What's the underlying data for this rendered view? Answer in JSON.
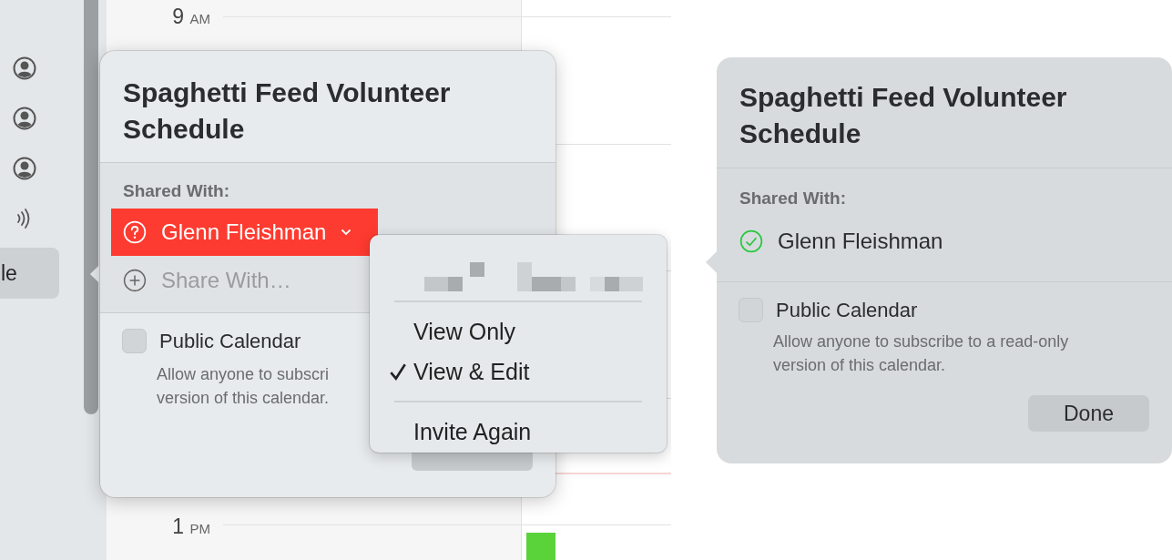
{
  "sidebar": {
    "items": [
      {
        "label": "le",
        "selected": true
      }
    ]
  },
  "calendar": {
    "times": [
      {
        "hour": "9",
        "period": "AM"
      },
      {
        "hour": "1",
        "period": "PM"
      }
    ]
  },
  "popovers": [
    {
      "title": "Spaghetti Feed Volunteer Schedule",
      "shared_with_label": "Shared With:",
      "invitee": {
        "name": "Glenn Fleishman",
        "accepted": false,
        "selected": true
      },
      "share_with": {
        "placeholder": "Share With…"
      },
      "public_calendar": {
        "label": "Public Calendar",
        "checked": false,
        "description": [
          "Allow anyone to subscri",
          "version of this calendar."
        ]
      }
    },
    {
      "title": "Spaghetti Feed Volunteer Schedule",
      "shared_with_label": "Shared With:",
      "invitee": {
        "name": "Glenn Fleishman",
        "accepted": true,
        "selected": false
      },
      "public_calendar": {
        "label": "Public Calendar",
        "checked": false,
        "description": [
          "Allow anyone to subscribe to a read-only",
          "version of this calendar."
        ]
      },
      "done_button": "Done"
    }
  ],
  "menu": {
    "items": [
      {
        "kind": "option",
        "label": "View Only",
        "selected": false
      },
      {
        "kind": "option",
        "label": "View & Edit",
        "selected": true
      },
      {
        "kind": "action",
        "label": "Invite Again"
      }
    ]
  }
}
